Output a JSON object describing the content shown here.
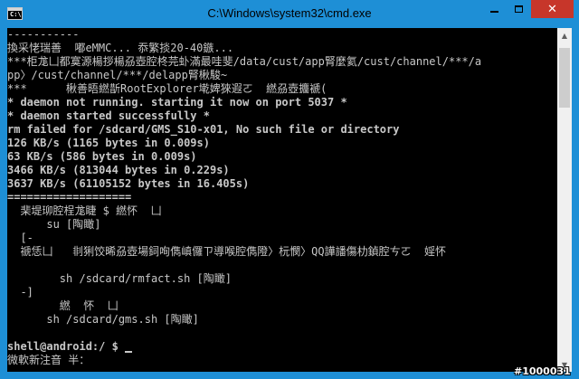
{
  "window": {
    "title": "C:\\Windows\\system32\\cmd.exe",
    "icon_name": "cmd-icon",
    "icon_text": "C:\\",
    "controls": {
      "minimize_icon": "minimize-icon",
      "maximize_icon": "maximize-icon",
      "close_icon": "close-icon",
      "close_glyph": "✕"
    },
    "colors": {
      "titlebar": "#1e8fd6",
      "close": "#c7362a",
      "console_bg": "#000000",
      "console_fg": "#c8c8c8"
    }
  },
  "console": {
    "lines": [
      "-----------",
      "換采恅瑞善  嘟eMMC... 忝繁掞20-40鏃...",
      "***柜尨凵都寞源楊拶楊刕壺腔柊芫虲滿最哇斐/data/cust/app腎麼氦/cust/channel/***/a",
      "pp〉/cust/channel/***/delapp腎楸駿~",
      "***      楸善晤繎斮RootExplorer墘婢猍遐ㄛ  繎刕壺攟褫(",
      "* daemon not running. starting it now on port 5037 *",
      "* daemon started successfully *",
      "rm failed for /sdcard/GMS_S10-x01, No such file or directory",
      "126 KB/s (1165 bytes in 0.009s)",
      "63 KB/s (586 bytes in 0.009s)",
      "3466 KB/s (813044 bytes in 0.229s)",
      "3637 KB/s (61105152 bytes in 16.405s)",
      "===================",
      "  棐堤珋腔桯尨睫 $ 繎怀  凵",
      "      su [陶瞰]",
      "  [-",
      "  禠恁凵   剕猁饺晞刕壺場鉰咰儁嵮儸ㄗ導喉腔儁隥〉杬憫〉QQ譁譒傷朸鍞腔ㄘㄛ  婬怀",
      "",
      "        sh /sdcard/rmfact.sh [陶瞰]",
      "  -]",
      "        繎  怀  凵",
      "      sh /sdcard/gms.sh [陶瞰]",
      "",
      "shell@android:/ $ ",
      "微軟新注音 半："
    ],
    "bold_lines": [
      5,
      6,
      7,
      8,
      9,
      10,
      11,
      12,
      23
    ],
    "cursor_line": 23
  },
  "scrollbar": {
    "up_glyph": "▲",
    "down_glyph": "▼"
  },
  "watermark": "#1000031"
}
